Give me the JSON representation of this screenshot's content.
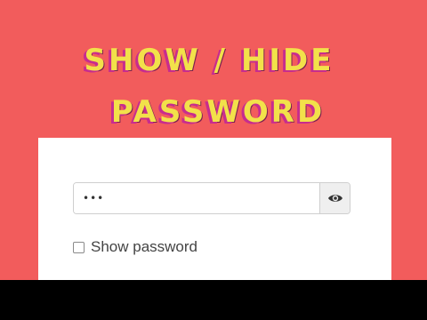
{
  "title": {
    "line1": "SHOW / HIDE",
    "line2": "PASSWORD"
  },
  "form": {
    "password_value": "•••",
    "eye_icon": "eye-icon",
    "show_password_label": "Show password",
    "show_password_checked": false
  },
  "colors": {
    "background": "#f25c5c",
    "title_text": "#f2e14a",
    "title_shadow": "#c72c8f",
    "letterbox": "#000000"
  }
}
